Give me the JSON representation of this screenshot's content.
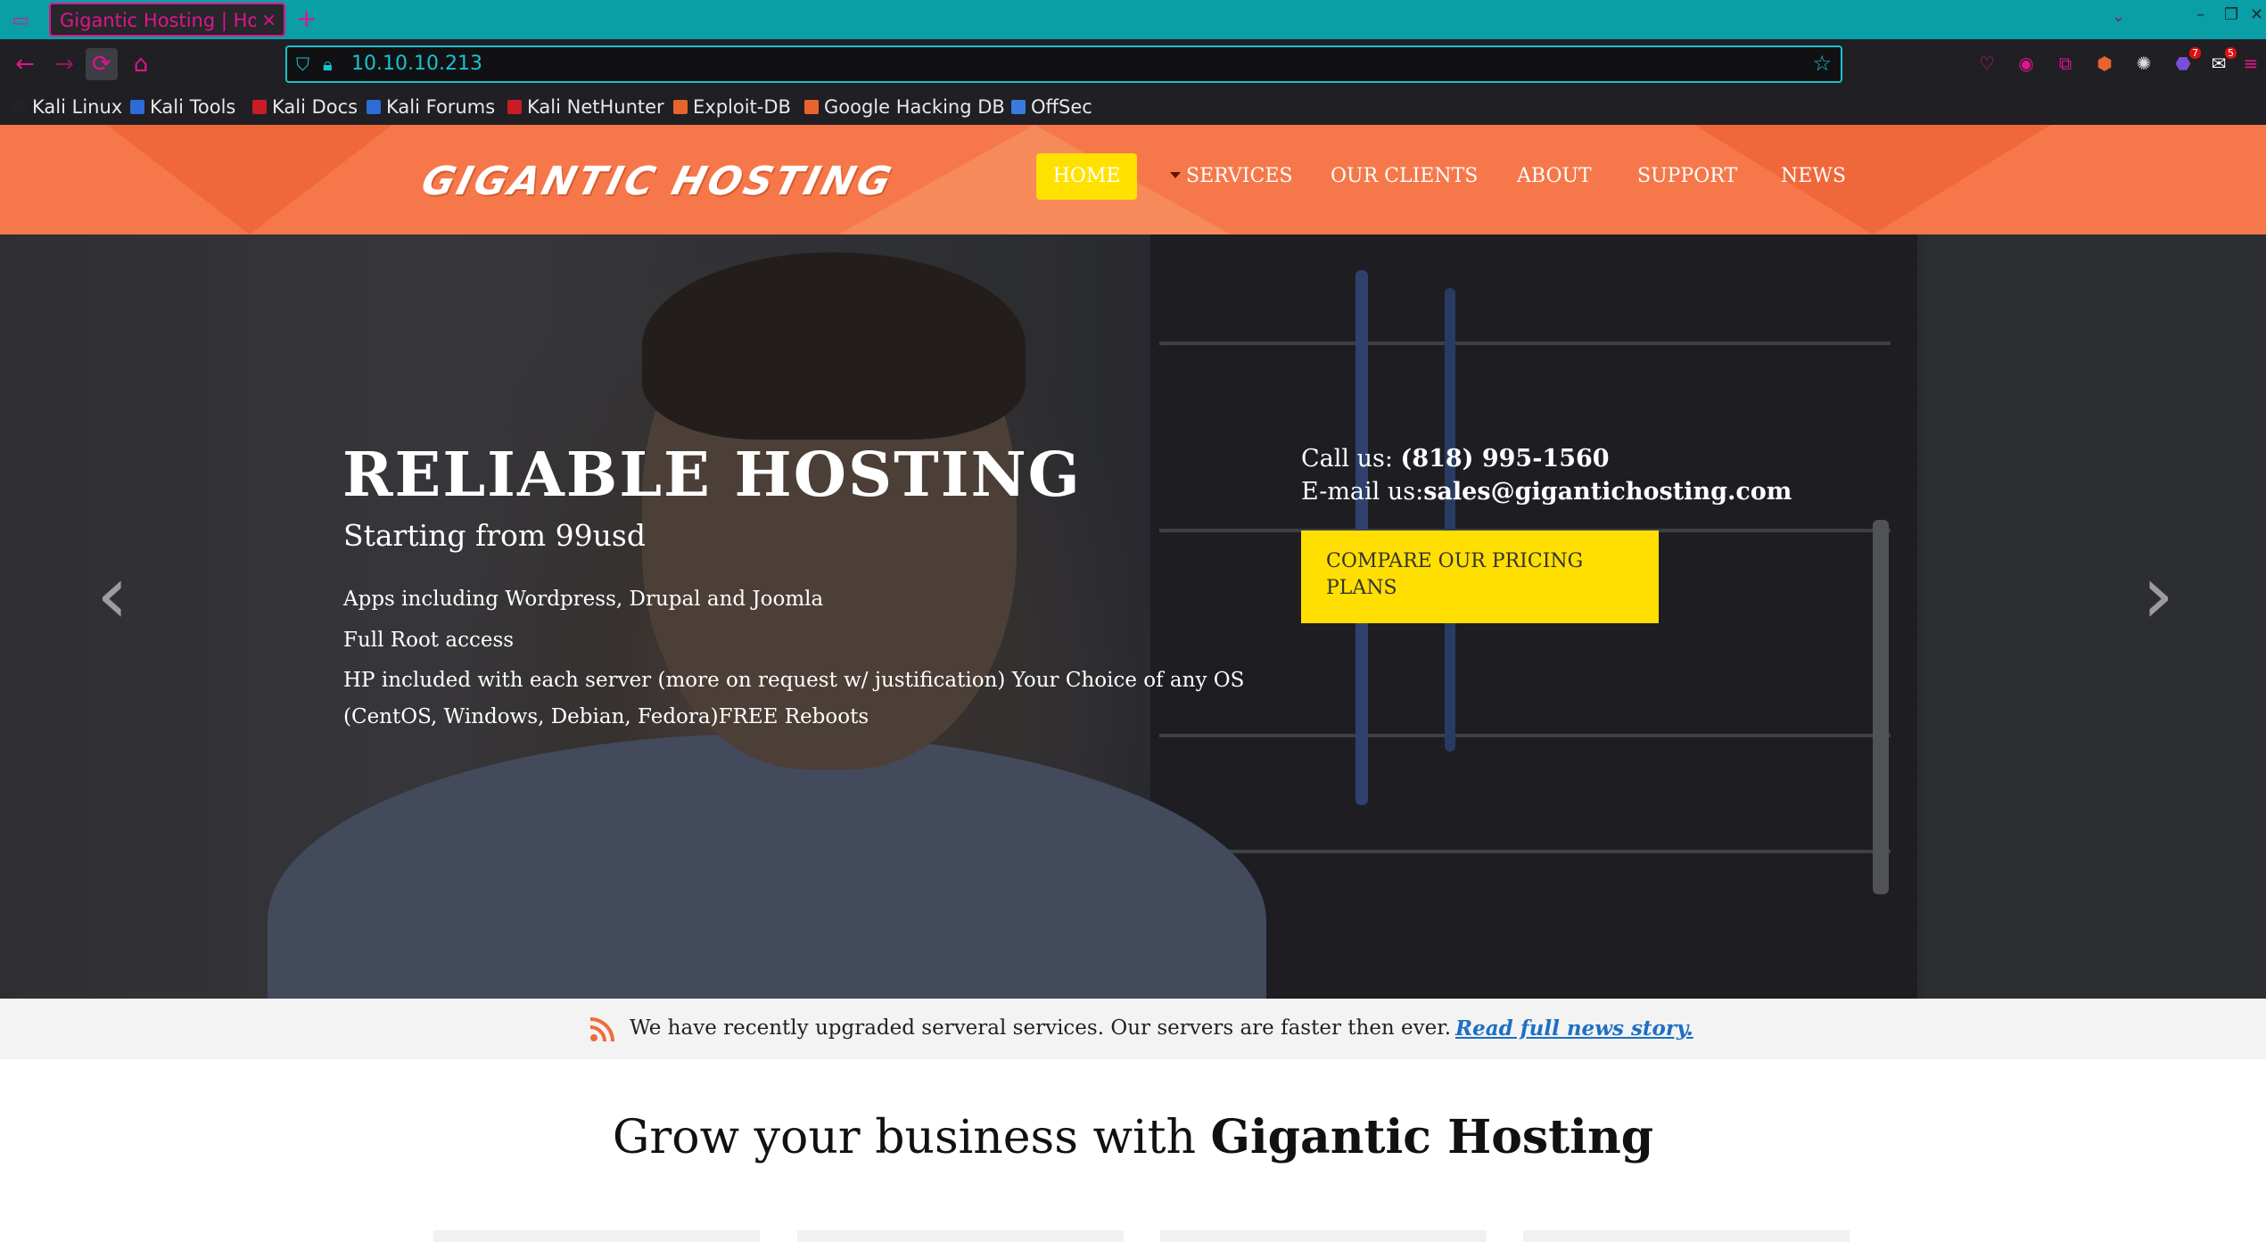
{
  "browser": {
    "tab_title": "Gigantic Hosting | Hon",
    "tab_close": "×",
    "new_tab": "+",
    "url": "10.10.10.213",
    "extension_badges": {
      "ext7": "7",
      "ext8": "5"
    }
  },
  "bookmarks": [
    {
      "label": "Kali Linux",
      "color": "#222222"
    },
    {
      "label": "Kali Tools",
      "color": "#2f6bd6"
    },
    {
      "label": "Kali Docs",
      "color": "#c81d25"
    },
    {
      "label": "Kali Forums",
      "color": "#2f6bd6"
    },
    {
      "label": "Kali NetHunter",
      "color": "#c81d25"
    },
    {
      "label": "Exploit-DB",
      "color": "#e8642c"
    },
    {
      "label": "Google Hacking DB",
      "color": "#e8642c"
    },
    {
      "label": "OffSec",
      "color": "#3a7ae0"
    }
  ],
  "site": {
    "logo": "GIGANTIC HOSTING",
    "accent_color": "#f6784a",
    "highlight_color": "#ffe100",
    "menu": {
      "home": "HOME",
      "services": "SERVICES",
      "clients": "OUR CLIENTS",
      "about": "ABOUT",
      "support": "SUPPORT",
      "news": "NEWS"
    },
    "hero": {
      "title": "RELIABLE HOSTING",
      "subtitle": "Starting from 99usd",
      "features": [
        "Apps including Wordpress, Drupal and Joomla",
        "Full Root access",
        "HP included with each server (more on request w/ justification) Your Choice of any OS",
        "(CentOS, Windows, Debian, Fedora)FREE Reboots"
      ],
      "call_label": "Call us: ",
      "phone": "(818) 995-1560",
      "email_label": "E-mail us:",
      "email": "sales@gigantichosting.com",
      "cta": "COMPARE OUR PRICING PLANS",
      "prev_arrow": "‹",
      "next_arrow": "›"
    },
    "news": {
      "text": "We have recently upgraded serveral services. Our servers are faster then ever.",
      "link": "Read full news story."
    },
    "section": {
      "heading_prefix": "Grow your business with ",
      "heading_brand": "Gigantic Hosting"
    }
  }
}
